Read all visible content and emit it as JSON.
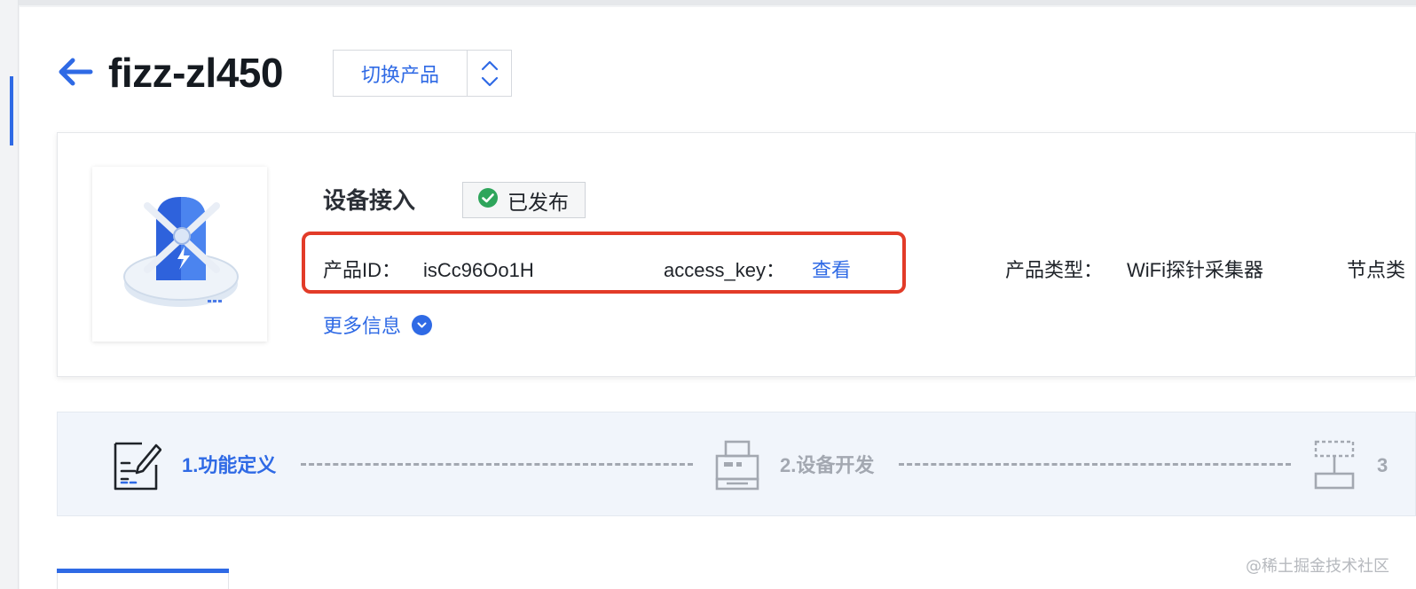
{
  "header": {
    "title": "fizz-zl450",
    "switch_product_label": "切换产品"
  },
  "product_card": {
    "section_title": "设备接入",
    "status_badge": "已发布",
    "fields": {
      "product_id_label": "产品ID：",
      "product_id_value": "isCc96Oo1H",
      "access_key_label": "access_key：",
      "access_key_action": "查看",
      "product_type_label": "产品类型：",
      "product_type_value": "WiFi探针采集器",
      "node_type_label_partial": "节点类"
    },
    "more_info_label": "更多信息"
  },
  "steps": [
    {
      "label": "1.功能定义",
      "state": "active"
    },
    {
      "label": "2.设备开发",
      "state": "inactive"
    },
    {
      "label": "3",
      "state": "inactive"
    }
  ],
  "colors": {
    "accent": "#2f6ae5",
    "highlight_border": "#e23b28",
    "status_ok": "#2ea55b",
    "step_inactive": "#a3a8b1"
  },
  "watermark": "@稀土掘金技术社区"
}
